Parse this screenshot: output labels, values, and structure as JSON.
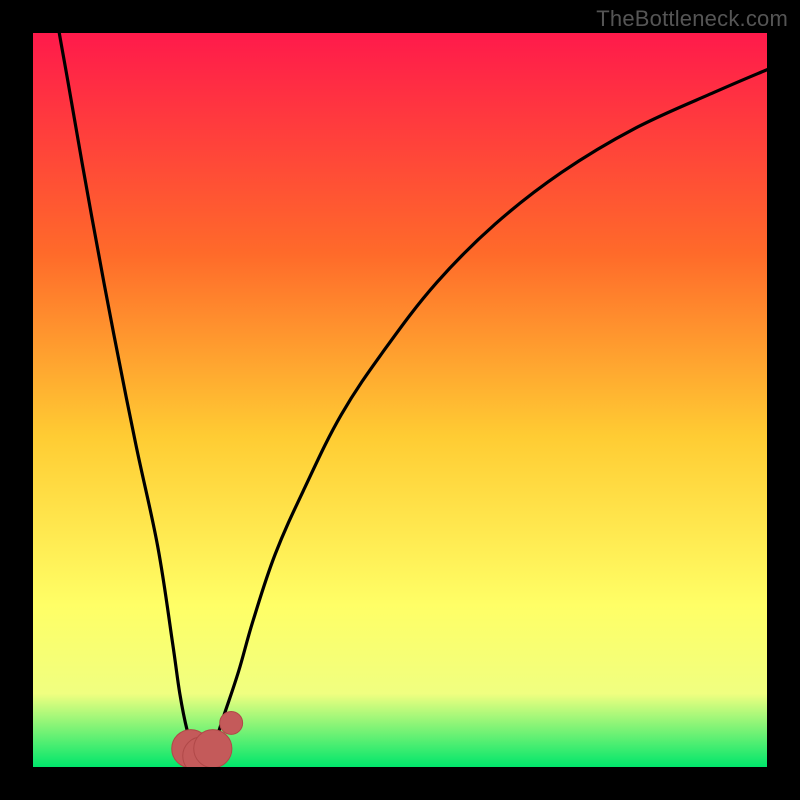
{
  "watermark": "TheBottleneck.com",
  "colors": {
    "frame": "#000000",
    "gradient_top": "#ff1a4b",
    "gradient_mid1": "#ff6a2a",
    "gradient_mid2": "#ffcc33",
    "gradient_mid3": "#ffff66",
    "gradient_mid4": "#f0ff80",
    "gradient_bottom": "#00e66b",
    "curve": "#000000",
    "marker_fill": "#c45a5a",
    "marker_stroke": "#b04848"
  },
  "chart_data": {
    "type": "line",
    "title": "",
    "xlabel": "",
    "ylabel": "",
    "xlim": [
      0,
      100
    ],
    "ylim": [
      0,
      100
    ],
    "notes": "Bottleneck-style V-curve. Y axis: 0 = no bottleneck (green, bottom), 100 = severe bottleneck (red, top). X axis: relative component strength (arbitrary 0-100). Minimum marked.",
    "series": [
      {
        "name": "bottleneck-curve",
        "x": [
          0,
          2,
          5,
          8,
          11,
          14,
          17,
          19,
          20,
          21,
          22,
          23,
          24,
          25,
          26,
          28,
          30,
          33,
          37,
          42,
          48,
          55,
          63,
          72,
          82,
          93,
          100
        ],
        "y": [
          130,
          110,
          92,
          75,
          59,
          44,
          30,
          17,
          10,
          5,
          2,
          1,
          2,
          4,
          7,
          13,
          20,
          29,
          38,
          48,
          57,
          66,
          74,
          81,
          87,
          92,
          95
        ]
      }
    ],
    "markers": [
      {
        "name": "min-region-left",
        "x": 21.5,
        "y": 2.5,
        "r": 2.0
      },
      {
        "name": "min-region-mid",
        "x": 23.0,
        "y": 1.5,
        "r": 2.0
      },
      {
        "name": "min-region-right",
        "x": 24.5,
        "y": 2.5,
        "r": 2.0
      },
      {
        "name": "secondary-point",
        "x": 27.0,
        "y": 6.0,
        "r": 1.2
      }
    ]
  }
}
